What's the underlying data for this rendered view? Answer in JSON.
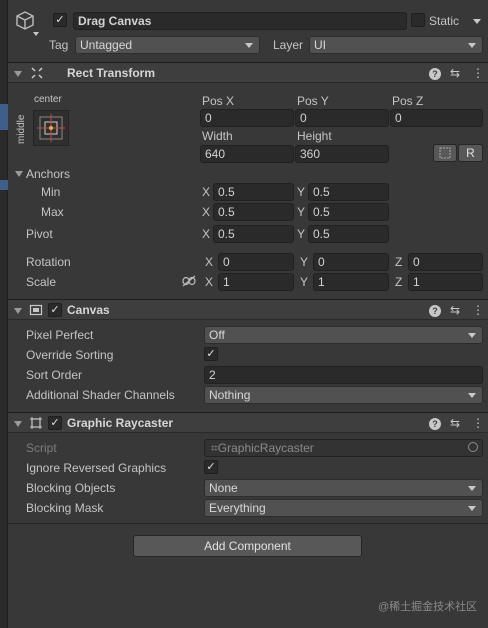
{
  "header": {
    "object_name": "Drag Canvas",
    "static_label": "Static",
    "tag_label": "Tag",
    "tag_value": "Untagged",
    "layer_label": "Layer",
    "layer_value": "UI"
  },
  "rect_transform": {
    "title": "Rect Transform",
    "anchor_preset_h": "center",
    "anchor_preset_v": "middle",
    "pos_x_label": "Pos X",
    "pos_x": "0",
    "pos_y_label": "Pos Y",
    "pos_y": "0",
    "pos_z_label": "Pos Z",
    "pos_z": "0",
    "width_label": "Width",
    "width": "640",
    "height_label": "Height",
    "height": "360",
    "raw_button": "R",
    "anchors_label": "Anchors",
    "min_label": "Min",
    "min_x": "0.5",
    "min_y": "0.5",
    "max_label": "Max",
    "max_x": "0.5",
    "max_y": "0.5",
    "pivot_label": "Pivot",
    "pivot_x": "0.5",
    "pivot_y": "0.5",
    "rotation_label": "Rotation",
    "rot_x": "0",
    "rot_y": "0",
    "rot_z": "0",
    "scale_label": "Scale",
    "scale_x": "1",
    "scale_y": "1",
    "scale_z": "1",
    "axis_x": "X",
    "axis_y": "Y",
    "axis_z": "Z"
  },
  "canvas": {
    "title": "Canvas",
    "pixel_perfect_label": "Pixel Perfect",
    "pixel_perfect_value": "Off",
    "override_sorting_label": "Override Sorting",
    "sort_order_label": "Sort Order",
    "sort_order_value": "2",
    "shader_channels_label": "Additional Shader Channels",
    "shader_channels_value": "Nothing"
  },
  "graphic_raycaster": {
    "title": "Graphic Raycaster",
    "script_label": "Script",
    "script_value": "GraphicRaycaster",
    "ignore_reversed_label": "Ignore Reversed Graphics",
    "blocking_objects_label": "Blocking Objects",
    "blocking_objects_value": "None",
    "blocking_mask_label": "Blocking Mask",
    "blocking_mask_value": "Everything"
  },
  "add_component_label": "Add Component",
  "watermark": "@稀土掘金技术社区",
  "checks": {
    "checkmark": "✓"
  },
  "colors": {
    "panel": "#383838",
    "header": "#3e3e3e",
    "field": "#2a2a2a",
    "dropdown": "#515151"
  }
}
